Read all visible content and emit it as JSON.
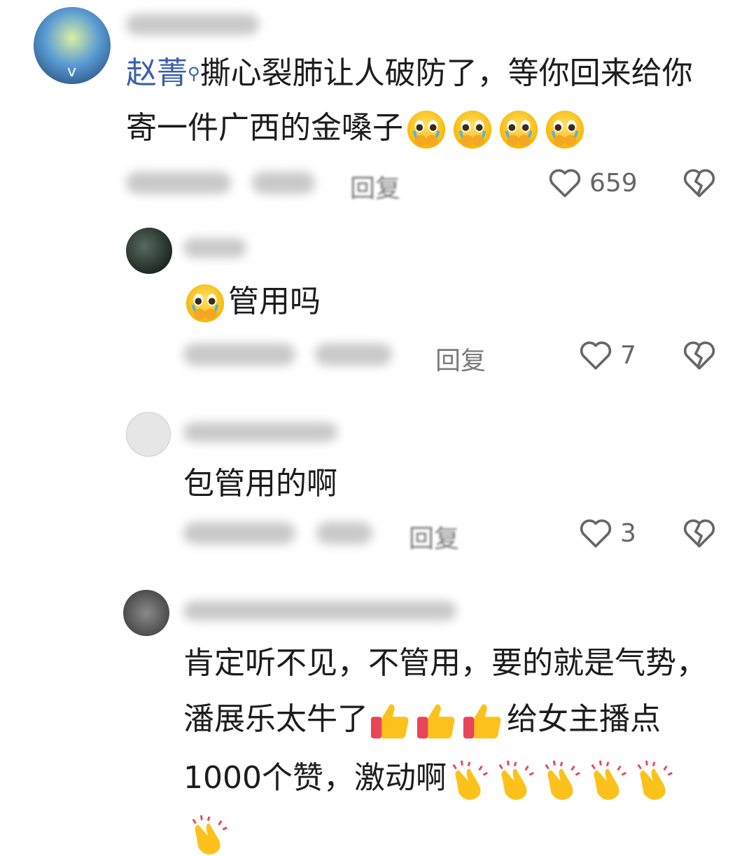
{
  "comments": [
    {
      "mention": "赵菁",
      "mention_icon": "search-icon",
      "line1": "撕心裂肺让人破防了，等你回来给你",
      "line2": "寄一件广西的金嗓子",
      "emoji": "crying-emoji",
      "emoji_count": 4,
      "reply_label": "回复",
      "likes": "659",
      "avatar_caption": "v"
    },
    {
      "text": "管用吗",
      "emoji": "crying-emoji",
      "reply_label": "回复",
      "likes": "7"
    },
    {
      "text": "包管用的啊",
      "reply_label": "回复",
      "likes": "3"
    },
    {
      "line1": "肯定听不见，不管用，要的就是气势，",
      "line2a": "潘展乐太牛了",
      "line2b": "给女主播点",
      "line3": "1000个赞，激动啊",
      "thumbs_emoji": "thumbs-up-emoji",
      "clap_emoji": "clapping-hands-emoji"
    }
  ],
  "colors": {
    "mention": "#3a5fa8",
    "meta_text": "#7a7a7a",
    "icon": "#666666"
  }
}
